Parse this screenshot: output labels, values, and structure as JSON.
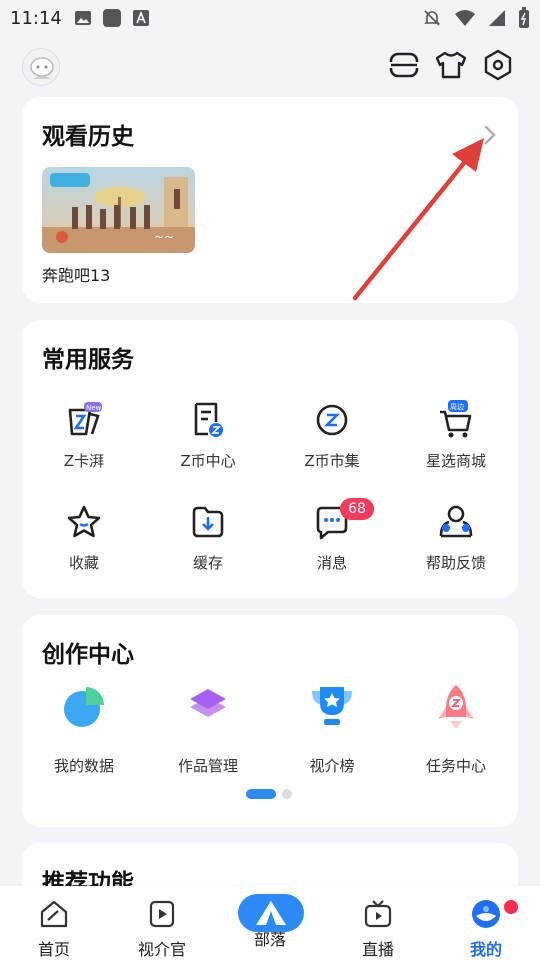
{
  "status_bar": {
    "time": "11:14"
  },
  "history": {
    "title": "观看历史",
    "item_name": "奔跑吧13"
  },
  "services": {
    "title": "常用服务",
    "items": [
      {
        "label": "Z卡湃",
        "icon": "z-card-icon",
        "tag": "New"
      },
      {
        "label": "Z币中心",
        "icon": "z-coin-center-icon"
      },
      {
        "label": "Z币市集",
        "icon": "z-coin-market-icon"
      },
      {
        "label": "星选商城",
        "icon": "cart-icon",
        "tag": "周边"
      },
      {
        "label": "收藏",
        "icon": "star-icon"
      },
      {
        "label": "缓存",
        "icon": "download-folder-icon"
      },
      {
        "label": "消息",
        "icon": "message-icon",
        "badge": "68"
      },
      {
        "label": "帮助反馈",
        "icon": "help-feedback-icon"
      }
    ]
  },
  "creation": {
    "title": "创作中心",
    "items": [
      {
        "label": "我的数据",
        "icon": "pie-chart-icon"
      },
      {
        "label": "作品管理",
        "icon": "layers-icon"
      },
      {
        "label": "视介榜",
        "icon": "trophy-icon"
      },
      {
        "label": "任务中心",
        "icon": "rocket-icon"
      }
    ]
  },
  "recommend": {
    "title": "推荐功能"
  },
  "bottom_nav": {
    "items": [
      {
        "label": "首页",
        "icon": "home-icon"
      },
      {
        "label": "视介官",
        "icon": "video-icon"
      },
      {
        "label": "部落",
        "icon": "tent-icon"
      },
      {
        "label": "直播",
        "icon": "tv-icon"
      },
      {
        "label": "我的",
        "icon": "mine-icon"
      }
    ]
  },
  "colors": {
    "accent": "#2c8af6",
    "badge": "#f23b5b",
    "arrow": "#e0403a"
  }
}
